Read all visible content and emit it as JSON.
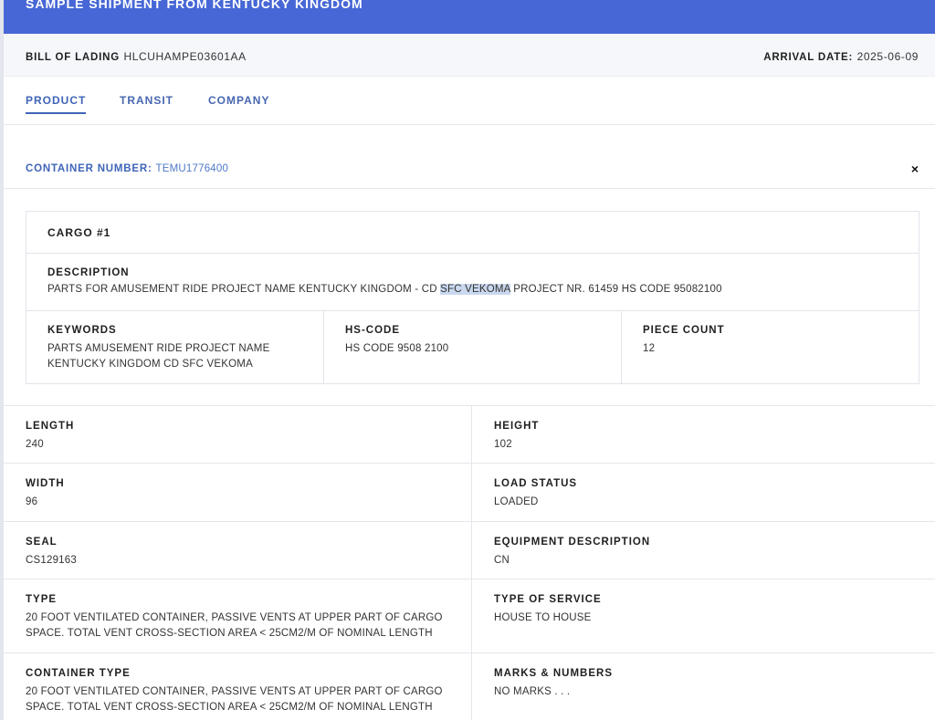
{
  "header": {
    "title": "SAMPLE SHIPMENT FROM KENTUCKY KINGDOM"
  },
  "bill_of_lading": {
    "label": "BILL OF LADING",
    "value": "HLCUHAMPE03601AA"
  },
  "arrival_date": {
    "label": "ARRIVAL DATE:",
    "value": "2025-06-09"
  },
  "tabs": [
    {
      "label": "PRODUCT",
      "active": true
    },
    {
      "label": "TRANSIT",
      "active": false
    },
    {
      "label": "COMPANY",
      "active": false
    }
  ],
  "container": {
    "label": "CONTAINER NUMBER:",
    "value": "TEMU1776400",
    "close_symbol": "×"
  },
  "cargo": {
    "title": "CARGO #1",
    "description_label": "DESCRIPTION",
    "description_before": "PARTS FOR AMUSEMENT RIDE PROJECT NAME KENTUCKY KINGDOM - CD ",
    "description_highlight": "SFC VEKOMA",
    "description_after": " PROJECT NR. 61459 HS CODE 95082100",
    "keywords_label": "KEYWORDS",
    "keywords_line1": "PARTS AMUSEMENT RIDE PROJECT NAME",
    "keywords_line2": "KENTUCKY KINGDOM CD SFC VEKOMA",
    "hs_code_label": "HS-CODE",
    "hs_code_value": "HS CODE 9508 2100",
    "piece_count_label": "PIECE COUNT",
    "piece_count_value": "12"
  },
  "properties": {
    "length": {
      "label": "LENGTH",
      "value": "240"
    },
    "height": {
      "label": "HEIGHT",
      "value": "102"
    },
    "width": {
      "label": "WIDTH",
      "value": "96"
    },
    "load_status": {
      "label": "LOAD STATUS",
      "value": "LOADED"
    },
    "seal": {
      "label": "SEAL",
      "value": "CS129163"
    },
    "equipment_description": {
      "label": "EQUIPMENT DESCRIPTION",
      "value": "CN"
    },
    "type": {
      "label": "TYPE",
      "line1": "20 FOOT VENTILATED CONTAINER, PASSIVE VENTS AT UPPER PART OF CARGO",
      "line2": "SPACE. TOTAL VENT CROSS-SECTION AREA < 25CM2/M OF NOMINAL LENGTH"
    },
    "type_of_service": {
      "label": "TYPE OF SERVICE",
      "value": "HOUSE TO HOUSE"
    },
    "container_type": {
      "label": "CONTAINER TYPE",
      "line1": "20 FOOT VENTILATED CONTAINER, PASSIVE VENTS AT UPPER PART OF CARGO",
      "line2": "SPACE. TOTAL VENT CROSS-SECTION AREA < 25CM2/M OF NOMINAL LENGTH"
    },
    "marks_numbers": {
      "label": "MARKS & NUMBERS",
      "value": "NO MARKS . . ."
    }
  },
  "colors": {
    "header_bg": "#4767d6",
    "accent": "#3f64b8",
    "highlight": "#c9d8ee"
  }
}
